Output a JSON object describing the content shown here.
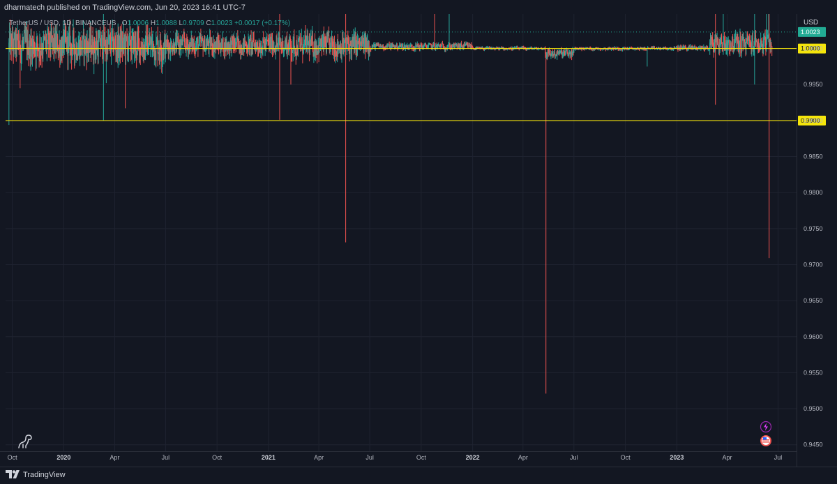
{
  "header": {
    "published_text": "dharmatech published on TradingView.com, Jun 20, 2023 16:41 UTC-7"
  },
  "legend": {
    "symbol": "TetherUS / USD, 1D, BINANCEUS",
    "open_label": "O",
    "open": "1.0006",
    "high_label": "H",
    "high": "1.0088",
    "low_label": "L",
    "low": "0.9709",
    "close_label": "C",
    "close": "1.0023",
    "change": "+0.0017 (+0.17%)"
  },
  "price_axis": {
    "currency": "USD"
  },
  "colors": {
    "background": "#131722",
    "up": "#26a69a",
    "down": "#ef5350",
    "hline": "#f5e50b",
    "price_label": "#22ab94"
  },
  "footer": {
    "brand": "TradingView"
  },
  "icons": [
    "dino-icon",
    "lightning-event-icon",
    "us-flag-event-icon",
    "tradingview-logo-icon"
  ],
  "chart_data": {
    "type": "candlestick",
    "title": "TetherUS / USD, 1D, BINANCEUS",
    "ylabel": "USD",
    "ylim": [
      0.9441,
      1.0048
    ],
    "ytick_values": [
      1.0,
      0.995,
      0.99,
      0.985,
      0.98,
      0.975,
      0.97,
      0.965,
      0.96,
      0.955,
      0.95,
      0.945
    ],
    "ytick_labels": [
      "1.0000",
      "0.9950",
      "0.9900",
      "0.9850",
      "0.9800",
      "0.9750",
      "0.9700",
      "0.9650",
      "0.9600",
      "0.9550",
      "0.9500",
      "0.9450"
    ],
    "xlim": [
      "2019-09-19",
      "2023-08-03"
    ],
    "x_ticks": [
      {
        "date": "2019-10-01",
        "label": "Oct",
        "bold": false
      },
      {
        "date": "2020-01-01",
        "label": "2020",
        "bold": true
      },
      {
        "date": "2020-04-01",
        "label": "Apr",
        "bold": false
      },
      {
        "date": "2020-07-01",
        "label": "Jul",
        "bold": false
      },
      {
        "date": "2020-10-01",
        "label": "Oct",
        "bold": false
      },
      {
        "date": "2021-01-01",
        "label": "2021",
        "bold": true
      },
      {
        "date": "2021-04-01",
        "label": "Apr",
        "bold": false
      },
      {
        "date": "2021-07-01",
        "label": "Jul",
        "bold": false
      },
      {
        "date": "2021-10-01",
        "label": "Oct",
        "bold": false
      },
      {
        "date": "2022-01-01",
        "label": "2022",
        "bold": true
      },
      {
        "date": "2022-04-01",
        "label": "Apr",
        "bold": false
      },
      {
        "date": "2022-07-01",
        "label": "Jul",
        "bold": false
      },
      {
        "date": "2022-10-01",
        "label": "Oct",
        "bold": false
      },
      {
        "date": "2023-01-01",
        "label": "2023",
        "bold": true
      },
      {
        "date": "2023-04-01",
        "label": "Apr",
        "bold": false
      },
      {
        "date": "2023-07-01",
        "label": "Jul",
        "bold": false
      }
    ],
    "horizontal_lines": [
      {
        "value": 1.0,
        "label": "1.0000"
      },
      {
        "value": 0.99,
        "label": "0.9900"
      }
    ],
    "last_price": {
      "value": 1.0023,
      "label": "1.0023"
    },
    "phases": [
      {
        "start": "2019-09-25",
        "end": "2020-06-30",
        "center": 1.0004,
        "noise": 0.0025
      },
      {
        "start": "2020-07-01",
        "end": "2021-01-31",
        "center": 1.0005,
        "noise": 0.0015
      },
      {
        "start": "2021-02-01",
        "end": "2021-06-30",
        "center": 1.0004,
        "noise": 0.0018
      },
      {
        "start": "2021-07-01",
        "end": "2021-12-31",
        "center": 1.0003,
        "noise": 0.0005
      },
      {
        "start": "2022-01-01",
        "end": "2022-05-10",
        "center": 1.0,
        "noise": 0.00025
      },
      {
        "start": "2022-05-11",
        "end": "2022-06-30",
        "center": 0.9993,
        "noise": 0.0007
      },
      {
        "start": "2022-07-01",
        "end": "2022-12-31",
        "center": 1.0,
        "noise": 0.00025
      },
      {
        "start": "2023-01-01",
        "end": "2023-02-28",
        "center": 1.0001,
        "noise": 0.0004
      },
      {
        "start": "2023-03-01",
        "end": "2023-06-20",
        "center": 1.0007,
        "noise": 0.0015
      }
    ],
    "wick_extremes": [
      {
        "date": "2019-09-25",
        "low": 0.9894
      },
      {
        "date": "2019-10-15",
        "low": 0.9945
      },
      {
        "date": "2020-03-12",
        "low": 0.99,
        "high": 1.006
      },
      {
        "date": "2020-03-17",
        "low": 0.9952
      },
      {
        "date": "2020-04-20",
        "low": 0.9917
      },
      {
        "date": "2021-01-21",
        "low": 0.9901,
        "high": 1.006
      },
      {
        "date": "2021-02-10",
        "low": 0.995
      },
      {
        "date": "2021-05-19",
        "low": 0.9731,
        "high": 1.006
      },
      {
        "date": "2021-10-25",
        "high": 1.006
      },
      {
        "date": "2021-11-20",
        "high": 1.006
      },
      {
        "date": "2022-05-12",
        "low": 0.9521
      },
      {
        "date": "2022-11-09",
        "low": 0.9975
      },
      {
        "date": "2023-03-11",
        "low": 0.9922,
        "high": 1.006
      },
      {
        "date": "2023-03-25",
        "high": 1.006
      },
      {
        "date": "2023-05-20",
        "low": 0.995,
        "high": 1.006
      },
      {
        "date": "2023-06-10",
        "high": 1.006
      },
      {
        "date": "2023-06-14",
        "high": 1.006
      },
      {
        "date": "2023-06-15",
        "low": 0.9709,
        "high": 1.0088
      }
    ]
  }
}
